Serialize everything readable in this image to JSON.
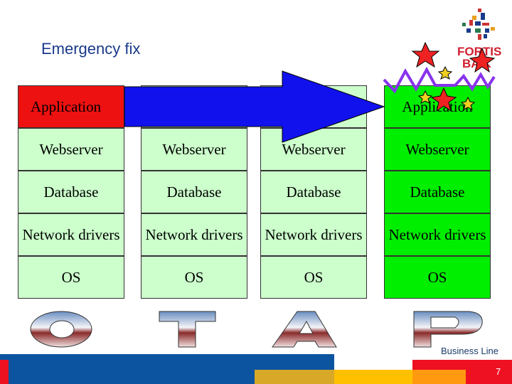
{
  "slide": {
    "title": "Emergency fix",
    "footer": "Business Line",
    "page_number": "7",
    "logo_text": "FORTIS BANK",
    "banner_letters": [
      "O",
      "T",
      "A",
      "P"
    ]
  },
  "columns": [
    {
      "cells": [
        "Application",
        "Webserver",
        "Database",
        "Network drivers",
        "OS"
      ]
    },
    {
      "cells": [
        "",
        "Webserver",
        "Database",
        "Network drivers",
        "OS"
      ]
    },
    {
      "cells": [
        "",
        "Webserver",
        "Database",
        "Network drivers",
        "OS"
      ]
    },
    {
      "cells": [
        "Application",
        "Webserver",
        "Database",
        "Network drivers",
        "OS"
      ]
    }
  ],
  "colors": {
    "red": "#ee1111",
    "light_green": "#ccffcc",
    "green": "#00ee00",
    "arrow": "#1111ee",
    "footer_blue": "#0d54a0"
  }
}
